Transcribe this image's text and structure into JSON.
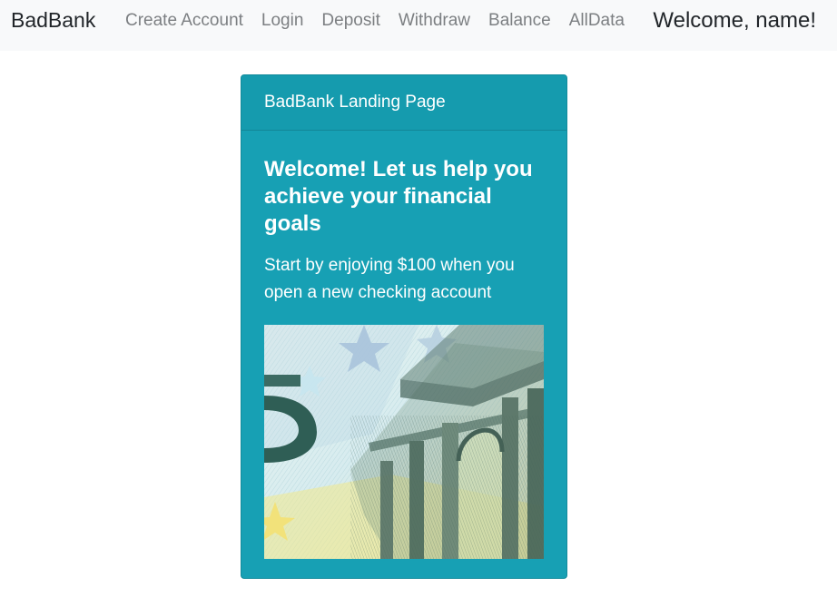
{
  "navbar": {
    "brand": "BadBank",
    "links": [
      {
        "label": "Create Account"
      },
      {
        "label": "Login"
      },
      {
        "label": "Deposit"
      },
      {
        "label": "Withdraw"
      },
      {
        "label": "Balance"
      },
      {
        "label": "AllData"
      }
    ],
    "welcome": "Welcome, name!"
  },
  "card": {
    "header": "BadBank Landing Page",
    "title": "Welcome! Let us help you achieve your financial goals",
    "text": "Start by enjoying $100 when you open a new checking account",
    "image_alt": "euro banknote"
  },
  "colors": {
    "card_background": "#17a0b4",
    "navbar_background": "#f8f9fa"
  }
}
